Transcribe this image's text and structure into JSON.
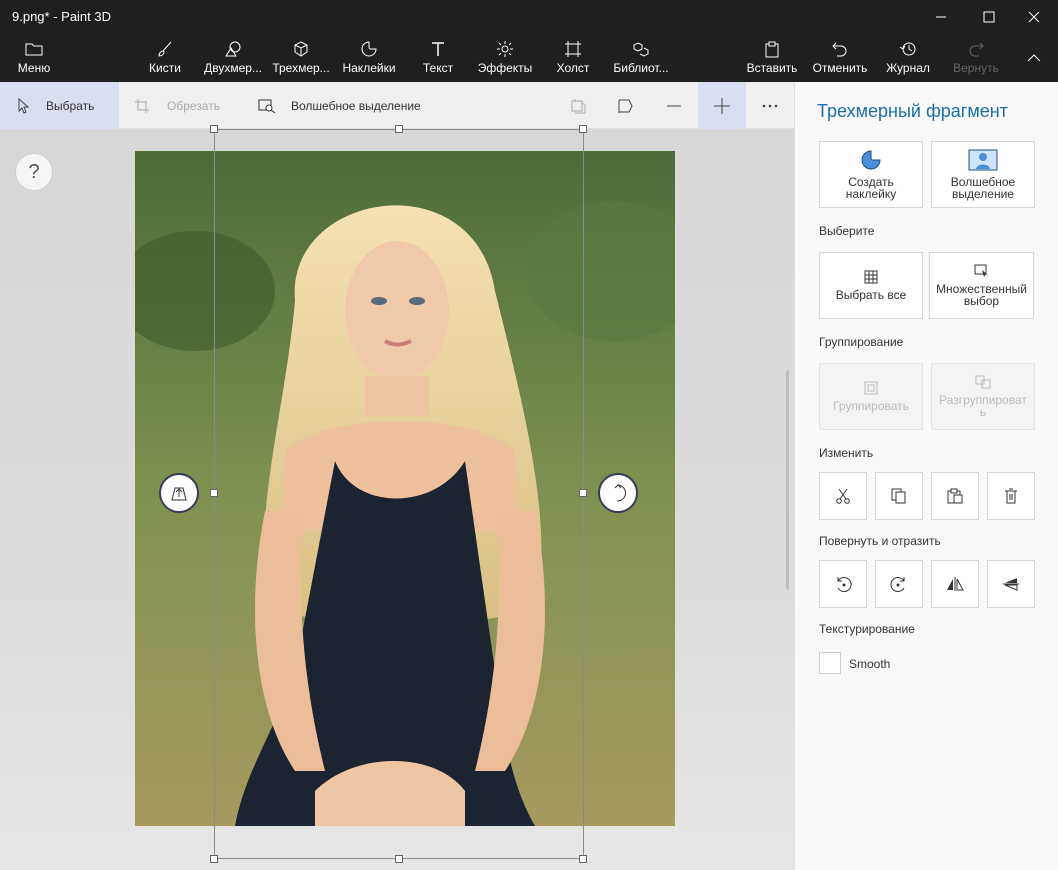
{
  "titlebar": {
    "title": "9.png* - Paint 3D"
  },
  "ribbon": {
    "menu": "Меню",
    "tools": [
      "Кисти",
      "Двухмер...",
      "Трехмер...",
      "Наклейки",
      "Текст",
      "Эффекты",
      "Холст",
      "Библиот..."
    ],
    "paste": "Вставить",
    "undo": "Отменить",
    "history": "Журнал",
    "redo": "Вернуть"
  },
  "toolbar": {
    "select": "Выбрать",
    "crop": "Обрезать",
    "magic": "Волшебное выделение"
  },
  "canvas": {
    "help": "?"
  },
  "panel": {
    "title": "Трехмерный фрагмент",
    "sticker": "Создать наклейку",
    "magic_select": "Волшебное выделение",
    "select_section": "Выберите",
    "select_all": "Выбрать все",
    "multi_select": "Множественный выбор",
    "group_section": "Группирование",
    "group": "Группировать",
    "ungroup": "Разгруппироват ь",
    "edit_section": "Изменить",
    "rotate_section": "Повернуть и отразить",
    "texture_section": "Текстурирование",
    "smooth": "Smooth"
  }
}
